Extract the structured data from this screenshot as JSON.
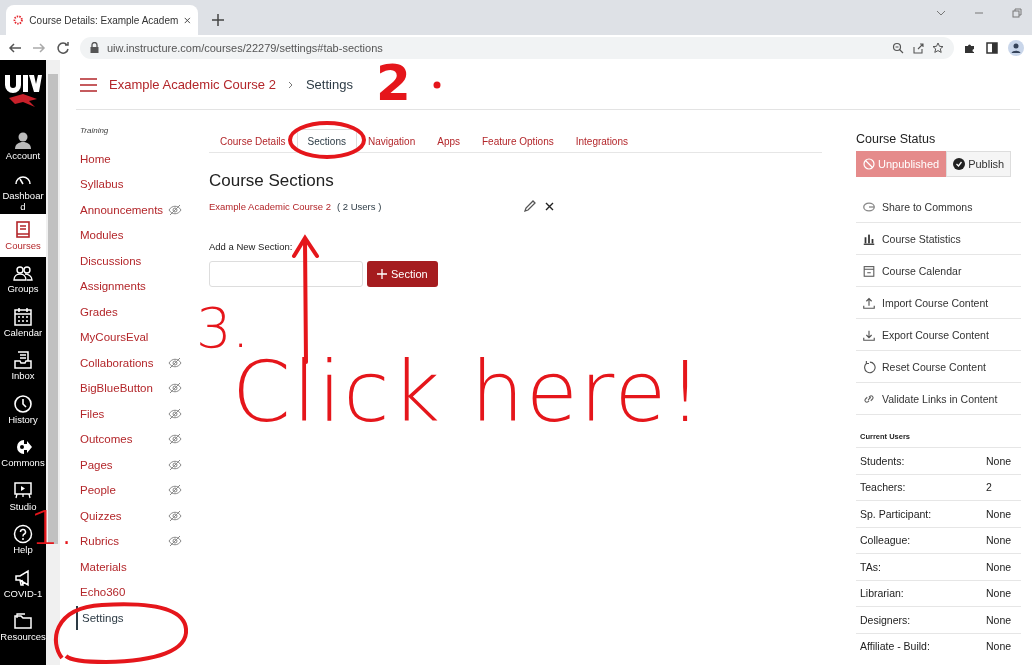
{
  "browser": {
    "tab_title": "Course Details: Example Academ",
    "url": "uiw.instructure.com/courses/22279/settings#tab-sections"
  },
  "global_nav": [
    {
      "label": "Account",
      "selected": false
    },
    {
      "label": "Dashboard",
      "selected": false
    },
    {
      "label": "Courses",
      "selected": true
    },
    {
      "label": "Groups",
      "selected": false
    },
    {
      "label": "Calendar",
      "selected": false
    },
    {
      "label": "Inbox",
      "selected": false
    },
    {
      "label": "History",
      "selected": false
    },
    {
      "label": "Commons",
      "selected": false
    },
    {
      "label": "Studio",
      "selected": false
    },
    {
      "label": "Help",
      "selected": false
    },
    {
      "label": "COVID-1",
      "selected": false
    },
    {
      "label": "Resources",
      "selected": false
    }
  ],
  "breadcrumb": [
    "Example Academic Course 2",
    "Settings"
  ],
  "course_nav": {
    "heading": "Training",
    "items": [
      {
        "label": "Home",
        "hidden": false,
        "selected": false
      },
      {
        "label": "Syllabus",
        "hidden": false,
        "selected": false
      },
      {
        "label": "Announcements",
        "hidden": true,
        "selected": false
      },
      {
        "label": "Modules",
        "hidden": false,
        "selected": false
      },
      {
        "label": "Discussions",
        "hidden": false,
        "selected": false
      },
      {
        "label": "Assignments",
        "hidden": false,
        "selected": false
      },
      {
        "label": "Grades",
        "hidden": false,
        "selected": false
      },
      {
        "label": "MyCoursEval",
        "hidden": false,
        "selected": false
      },
      {
        "label": "Collaborations",
        "hidden": true,
        "selected": false
      },
      {
        "label": "BigBlueButton",
        "hidden": true,
        "selected": false
      },
      {
        "label": "Files",
        "hidden": true,
        "selected": false
      },
      {
        "label": "Outcomes",
        "hidden": true,
        "selected": false
      },
      {
        "label": "Pages",
        "hidden": true,
        "selected": false
      },
      {
        "label": "People",
        "hidden": true,
        "selected": false
      },
      {
        "label": "Quizzes",
        "hidden": true,
        "selected": false
      },
      {
        "label": "Rubrics",
        "hidden": true,
        "selected": false
      },
      {
        "label": "Materials",
        "hidden": false,
        "selected": false
      },
      {
        "label": "Echo360",
        "hidden": false,
        "selected": false
      },
      {
        "label": "Settings",
        "hidden": false,
        "selected": true
      }
    ]
  },
  "settings_tabs": [
    {
      "label": "Course Details",
      "selected": false
    },
    {
      "label": "Sections",
      "selected": true
    },
    {
      "label": "Navigation",
      "selected": false
    },
    {
      "label": "Apps",
      "selected": false
    },
    {
      "label": "Feature Options",
      "selected": false
    },
    {
      "label": "Integrations",
      "selected": false
    }
  ],
  "sections": {
    "heading": "Course Sections",
    "items": [
      {
        "name": "Example Academic Course 2",
        "users": "( 2 Users )"
      }
    ],
    "add_label": "Add a New Section:",
    "add_button": "Section"
  },
  "sidebar": {
    "heading": "Course Status",
    "published": false,
    "unpublished_label": "Unpublished",
    "publish_label": "Publish",
    "links": [
      "Share to Commons",
      "Course Statistics",
      "Course Calendar",
      "Import Course Content",
      "Export Course Content",
      "Reset Course Content",
      "Validate Links in Content"
    ],
    "users_heading": "Current Users",
    "users": [
      {
        "role": "Students:",
        "count": "None"
      },
      {
        "role": "Teachers:",
        "count": "2"
      },
      {
        "role": "Sp. Participant:",
        "count": "None"
      },
      {
        "role": "Colleague:",
        "count": "None"
      },
      {
        "role": "TAs:",
        "count": "None"
      },
      {
        "role": "Librarian:",
        "count": "None"
      },
      {
        "role": "Designers:",
        "count": "None"
      },
      {
        "role": "Affiliate - Build:",
        "count": "None"
      }
    ]
  },
  "annotations": [
    "1.",
    "2",
    "3.",
    "Click here!"
  ]
}
